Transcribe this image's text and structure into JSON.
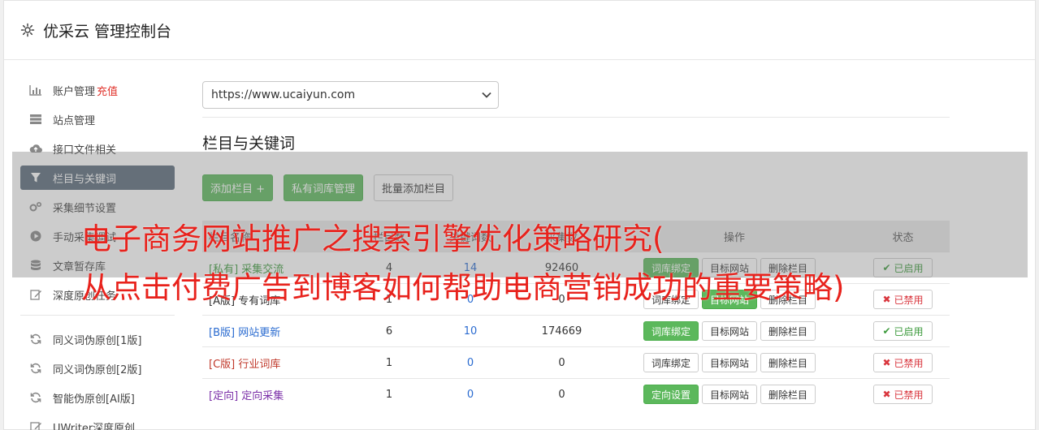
{
  "app": {
    "title": "优采云 管理控制台"
  },
  "sidebar": {
    "items": [
      {
        "label": "账户管理",
        "badge": "充值",
        "icon": "bar-chart-icon"
      },
      {
        "label": "站点管理",
        "icon": "server-icon"
      },
      {
        "label": "接口文件相关",
        "icon": "cloud-upload-icon"
      },
      {
        "label": "栏目与关键词",
        "icon": "filter-icon"
      },
      {
        "label": "采集细节设置",
        "icon": "gears-icon"
      },
      {
        "label": "手动采集调试",
        "icon": "play-circle-icon"
      },
      {
        "label": "文章暂存库",
        "icon": "database-icon"
      },
      {
        "label": "深度原创任务",
        "icon": "edit-icon"
      }
    ],
    "items2": [
      {
        "label": "同义词伪原创[1版]",
        "icon": "refresh-icon"
      },
      {
        "label": "同义词伪原创[2版]",
        "icon": "refresh-icon"
      },
      {
        "label": "智能伪原创[AI版]",
        "icon": "refresh-icon"
      },
      {
        "label": "UWriter深度原创",
        "icon": "edit-icon"
      }
    ]
  },
  "main": {
    "site_select": "https://www.ucaiyun.com",
    "section_title": "栏目与关键词",
    "buttons": {
      "add": "添加栏目 +",
      "private": "私有词库管理",
      "batch": "批量添加栏目"
    },
    "table": {
      "headers": {
        "name": "栏目名称",
        "n1": "栏目数",
        "n2": "关键词数",
        "n3": "采集数",
        "ops": "操作",
        "status": "状态"
      },
      "rows": [
        {
          "tag": "[私有]",
          "name": "采集交流",
          "n1": "4",
          "n2": "14",
          "n3": "92460",
          "op1": "词库绑定",
          "op2": "目标网站",
          "op3": "删除栏目",
          "status": "已启用"
        },
        {
          "tag": "[A版]",
          "name": "专有词库",
          "n1": "1",
          "n2": "0",
          "n3": "0",
          "op1": "词库绑定",
          "op2": "目标网站",
          "op3": "删除栏目",
          "status": "已禁用"
        },
        {
          "tag": "[B版]",
          "name": "网站更新",
          "n1": "6",
          "n2": "10",
          "n3": "174669",
          "op1": "词库绑定",
          "op2": "目标网站",
          "op3": "删除栏目",
          "status": "已启用"
        },
        {
          "tag": "[C版]",
          "name": "行业词库",
          "n1": "1",
          "n2": "0",
          "n3": "0",
          "op1": "词库绑定",
          "op2": "目标网站",
          "op3": "删除栏目",
          "status": "已禁用"
        },
        {
          "tag": "[定向]",
          "name": "定向采集",
          "n1": "1",
          "n2": "0",
          "n3": "0",
          "op1": "定向设置",
          "op2": "目标网站",
          "op3": "删除栏目",
          "status": "已禁用"
        }
      ]
    }
  },
  "overlay": {
    "line1": "电子商务网站推广之搜索引擎优化策略研究(",
    "line2": "从点击付费广告到博客如何帮助电商营销成功的重要策略)"
  },
  "colors": {
    "accent_green": "#5cb85c",
    "overlay_text": "#e8221c",
    "active_sidebar": "#5a6a7a"
  }
}
